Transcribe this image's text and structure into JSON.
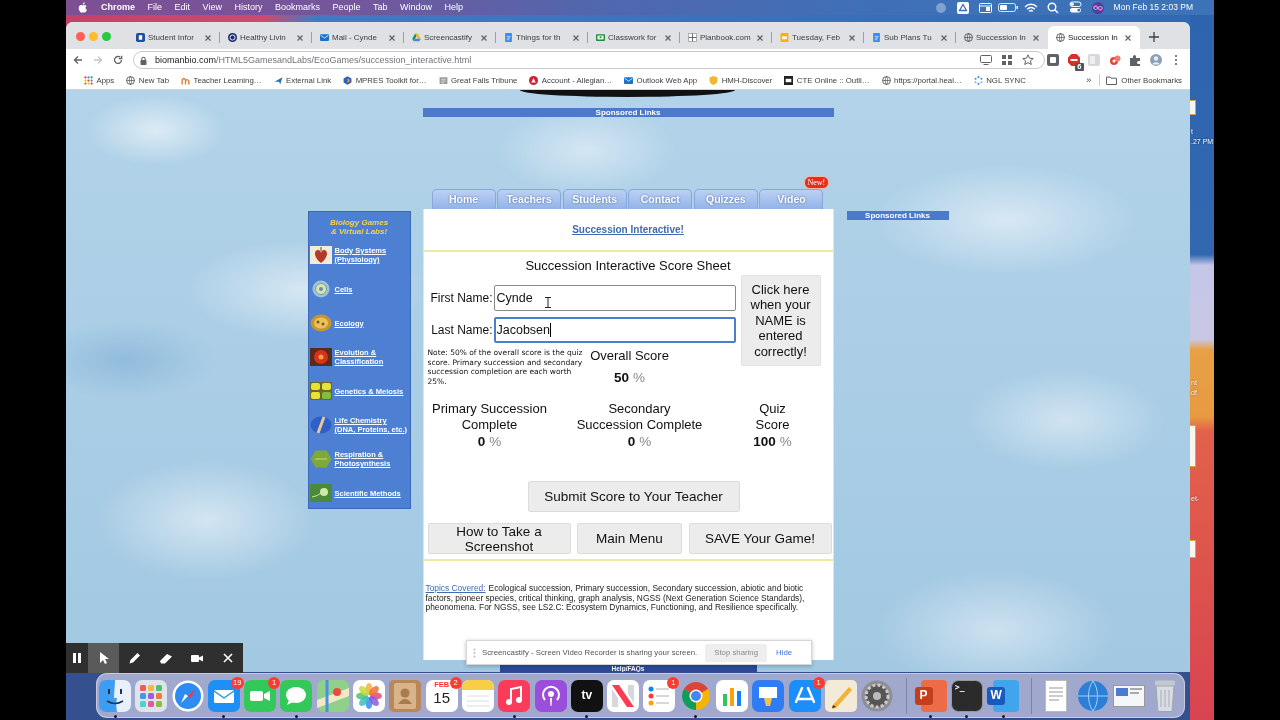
{
  "menu_bar": {
    "app": "Chrome",
    "menus": [
      "File",
      "Edit",
      "View",
      "History",
      "Bookmarks",
      "People",
      "Tab",
      "Window",
      "Help"
    ],
    "clock": "Mon Feb 15 2:03 PM"
  },
  "browser": {
    "tabs": [
      {
        "title": "Student Infor",
        "kind": "square",
        "selected": false
      },
      {
        "title": "Healthy Livin",
        "kind": "emblem",
        "selected": false
      },
      {
        "title": "Mail - Cynde",
        "kind": "envelope",
        "selected": false
      },
      {
        "title": "Screencastify",
        "kind": "drive",
        "selected": false
      },
      {
        "title": "Things for th",
        "kind": "document",
        "selected": false
      },
      {
        "title": "Classwork for",
        "kind": "board",
        "selected": false
      },
      {
        "title": "Planbook.com",
        "kind": "grid",
        "selected": false
      },
      {
        "title": "Tuesday, Feb",
        "kind": "slides",
        "selected": false
      },
      {
        "title": "Sub Plans Tu",
        "kind": "document",
        "selected": false
      },
      {
        "title": "Succession In",
        "kind": "globe",
        "selected": false
      },
      {
        "title": "Succession In",
        "kind": "globe",
        "selected": true
      }
    ],
    "history": {
      "back": true,
      "forward": false
    },
    "url": "biomanbio.com/HTML5GamesandLabs/EcoGames/succession_interactive.html",
    "extension_badge": "6",
    "bookmarks": [
      {
        "label": "Apps",
        "kind": "apps"
      },
      {
        "label": "New Tab",
        "kind": "globe"
      },
      {
        "label": "Teacher Learning…",
        "kind": "arch"
      },
      {
        "label": "External Link",
        "kind": "arrow"
      },
      {
        "label": "MPRES Toolkit for…",
        "kind": "hexagon"
      },
      {
        "label": "Great Falls Tribune",
        "kind": "newspaper"
      },
      {
        "label": "Account - Allegian…",
        "kind": "triangle-circle"
      },
      {
        "label": "Outlook Web App",
        "kind": "envelope"
      },
      {
        "label": "HMH-Discover",
        "kind": "shield"
      },
      {
        "label": "CTE Online :: Outli…",
        "kind": "square-logo"
      },
      {
        "label": "https://portal.heal…",
        "kind": "globe"
      },
      {
        "label": "NGL SYNC",
        "kind": "dots"
      }
    ],
    "bookmarks_overflow": "»",
    "other_bookmarks": "Other Bookmarks"
  },
  "page": {
    "top_sponsor": "Sponsored Links",
    "nav_tabs": [
      "Home",
      "Teachers",
      "Students",
      "Contact",
      "Quizzes",
      "Video"
    ],
    "new_badge": "New!",
    "side_sponsor": "Sponsored Links",
    "sidebar": {
      "title": "Biology Games & Virtual Labs!",
      "items": [
        {
          "label": "Body Systems (Physiology)",
          "kind": "heart"
        },
        {
          "label": "Cells",
          "kind": "cell"
        },
        {
          "label": "Ecology",
          "kind": "disc"
        },
        {
          "label": "Evolution & Classification",
          "kind": "flower"
        },
        {
          "label": "Genetics & Meiosis",
          "kind": "peas"
        },
        {
          "label": "Life Chemistry (DNA, Proteins, etc.)",
          "kind": "capsule"
        },
        {
          "label": "Respiration & Photosynthesis",
          "kind": "hexagon"
        },
        {
          "label": "Scientific Methods",
          "kind": "sprout"
        }
      ]
    },
    "heading_link": "Succession Interactive!",
    "score_sheet": {
      "title": "Succession Interactive Score Sheet",
      "fields": [
        {
          "label": "First Name:",
          "value": "Cynde",
          "focused": false
        },
        {
          "label": "Last Name:",
          "value": "Jacobsen",
          "focused": true
        }
      ],
      "confirm_button": "Click here when your NAME is entered correctly!",
      "note": "Note: 50% of the overall score is the quiz score. Primary succession and secondary succession completion are each worth 25%.",
      "overall": {
        "label": "Overall Score",
        "value": "**50** %"
      },
      "scores": [
        {
          "label": "Primary Succession Complete",
          "value": "**0** %"
        },
        {
          "label": "Secondary Succession Complete",
          "value": "**0** %"
        },
        {
          "label": "Quiz Score",
          "value": "**100** %"
        }
      ],
      "submit_button": "Submit Score to Your Teacher",
      "buttons": [
        "How to Take a Screenshot",
        "Main Menu",
        "SAVE Your Game!"
      ]
    },
    "topics": {
      "link": "Topics Covered:",
      "text": "Ecological succession, Primary succession, Secondary succession, abiotic and biotic factors, pioneer species, critical thinking, graph analysis, NGSS (Next Generation Science Standards), pheonomena. For NGSS, see LS2.C: Ecosystem Dynamics, Functioning, and Resilience specifically."
    },
    "footer_link": "Help/FAQs"
  },
  "recorder_toolbar": {
    "tools": [
      {
        "kind": "pause",
        "selected": false
      },
      {
        "kind": "pointer",
        "selected": true
      },
      {
        "kind": "pen",
        "selected": false
      },
      {
        "kind": "highlighter",
        "selected": false
      },
      {
        "kind": "camera",
        "selected": false
      },
      {
        "kind": "close",
        "selected": false
      }
    ]
  },
  "share_banner": {
    "message": "Screencastify - Screen Video Recorder is sharing your screen.",
    "stop_button": "Stop sharing",
    "hide_link": "Hide"
  },
  "dock": {
    "groups": [
      [
        {
          "kind": "finder",
          "running": true
        },
        {
          "kind": "launchpad",
          "running": false
        },
        {
          "kind": "safari",
          "running": false
        },
        {
          "kind": "mail",
          "running": true,
          "badge": "19"
        },
        {
          "kind": "facetime",
          "running": false,
          "badge": "1"
        },
        {
          "kind": "messages",
          "running": true
        },
        {
          "kind": "maps",
          "running": false
        },
        {
          "kind": "photos",
          "running": false
        },
        {
          "kind": "contacts",
          "running": false
        },
        {
          "kind": "calendar",
          "running": false,
          "badge": "2",
          "month": "FEB",
          "day": "15"
        },
        {
          "kind": "notes",
          "running": false
        },
        {
          "kind": "music",
          "running": true
        },
        {
          "kind": "podcasts",
          "running": false
        },
        {
          "kind": "tv",
          "running": true,
          "glyph": "tv"
        },
        {
          "kind": "news",
          "running": false
        },
        {
          "kind": "reminders",
          "running": false,
          "badge": "1"
        },
        {
          "kind": "chrome",
          "running": true
        },
        {
          "kind": "numbers",
          "running": false
        },
        {
          "kind": "keynote",
          "running": false
        },
        {
          "kind": "appstore",
          "running": false,
          "badge": "1"
        },
        {
          "kind": "pencil",
          "running": false
        },
        {
          "kind": "gear",
          "running": false
        }
      ],
      [
        {
          "kind": "powerpoint",
          "running": true,
          "glyph": "P"
        },
        {
          "kind": "terminal",
          "running": true,
          "glyph": ">_"
        },
        {
          "kind": "word",
          "running": true,
          "glyph": "W"
        }
      ],
      [
        {
          "kind": "document"
        },
        {
          "kind": "globe"
        },
        {
          "kind": "screenshot"
        },
        {
          "kind": "trash"
        }
      ]
    ]
  },
  "desktop": {
    "file_labels": [
      [
        "t",
        ".27 PM"
      ],
      [
        "nt",
        "df"
      ],
      [
        "et-"
      ]
    ]
  }
}
